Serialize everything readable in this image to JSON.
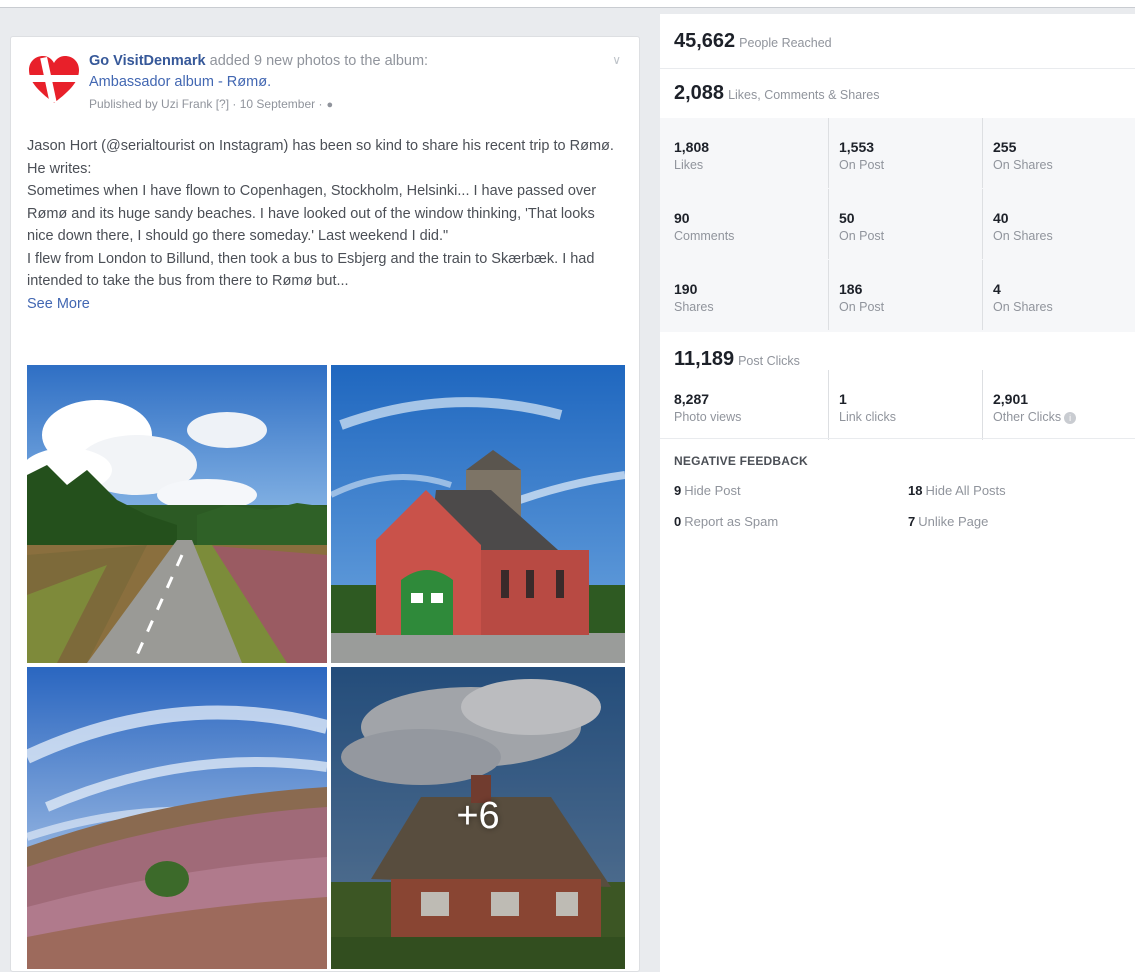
{
  "post": {
    "page_name": "Go VisitDenmark",
    "action_text": "added 9 new photos to the album:",
    "album_name": "Ambassador album - Rømø.",
    "published_by": "Published by Uzi Frank [?] · 10 September ·",
    "body_paragraphs": [
      "Jason Hort (@serialtourist on Instagram) has been so kind to share his recent trip to Rømø. He writes:",
      "Sometimes when I have flown to Copenhagen, Stockholm, Helsinki... I have passed over Rømø and its huge sandy beaches. I have looked out of the window thinking, 'That looks nice down there, I should go there someday.' Last weekend I did.\"",
      "I flew from London to Billund, then took a bus to Esbjerg and the train to Skærbæk. I had intended to take the bus from there to Rømø but..."
    ],
    "see_more": "See More",
    "more_photos": "+6",
    "colors": {
      "link": "#4267b2",
      "name": "#365899",
      "logo_red": "#e8202a"
    }
  },
  "insights": {
    "reached": {
      "value": "45,662",
      "label": "People Reached"
    },
    "engagement": {
      "value": "2,088",
      "label": "Likes, Comments & Shares"
    },
    "likes": [
      {
        "value": "1,808",
        "label": "Likes"
      },
      {
        "value": "1,553",
        "label": "On Post"
      },
      {
        "value": "255",
        "label": "On Shares"
      }
    ],
    "comments": [
      {
        "value": "90",
        "label": "Comments"
      },
      {
        "value": "50",
        "label": "On Post"
      },
      {
        "value": "40",
        "label": "On Shares"
      }
    ],
    "shares": [
      {
        "value": "190",
        "label": "Shares"
      },
      {
        "value": "186",
        "label": "On Post"
      },
      {
        "value": "4",
        "label": "On Shares"
      }
    ],
    "post_clicks": {
      "value": "11,189",
      "label": "Post Clicks"
    },
    "clicks": [
      {
        "value": "8,287",
        "label": "Photo views"
      },
      {
        "value": "1",
        "label": "Link clicks"
      },
      {
        "value": "2,901",
        "label": "Other Clicks"
      }
    ],
    "negative_feedback": {
      "title": "NEGATIVE FEEDBACK",
      "hide_post": {
        "value": "9",
        "label": "Hide Post"
      },
      "hide_all_posts": {
        "value": "18",
        "label": "Hide All Posts"
      },
      "report_spam": {
        "value": "0",
        "label": "Report as Spam"
      },
      "unlike_page": {
        "value": "7",
        "label": "Unlike Page"
      }
    }
  }
}
